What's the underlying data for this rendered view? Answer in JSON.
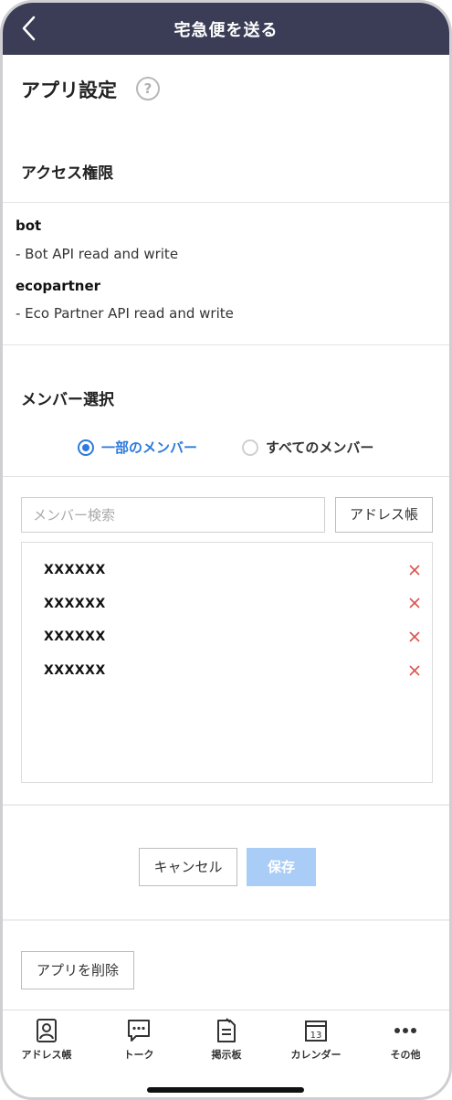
{
  "header": {
    "title": "宅急便を送る"
  },
  "page": {
    "title": "アプリ設定",
    "help_glyph": "?"
  },
  "access": {
    "title": "アクセス権限",
    "permissions": [
      {
        "name": "bot",
        "desc": "- Bot API read and write"
      },
      {
        "name": "ecopartner",
        "desc": "- Eco Partner API read and write"
      }
    ]
  },
  "members": {
    "title": "メンバー選択",
    "options": [
      {
        "label": "一部のメンバー",
        "selected": true
      },
      {
        "label": "すべてのメンバー",
        "selected": false
      }
    ],
    "search_placeholder": "メンバー検索",
    "address_book_label": "アドレス帳",
    "list": [
      "XXXXXX",
      "XXXXXX",
      "XXXXXX",
      "XXXXXX"
    ]
  },
  "actions": {
    "cancel_label": "キャンセル",
    "save_label": "保存",
    "delete_label": "アプリを削除"
  },
  "bottom_nav": {
    "items": [
      {
        "label": "アドレス帳",
        "icon": "address-book-icon"
      },
      {
        "label": "トーク",
        "icon": "chat-icon"
      },
      {
        "label": "掲示板",
        "icon": "board-icon"
      },
      {
        "label": "カレンダー",
        "icon": "calendar-icon",
        "day": "13"
      },
      {
        "label": "その他",
        "icon": "more-icon"
      }
    ]
  },
  "colors": {
    "header_bg": "#3a3d55",
    "accent": "#2d7bdc",
    "save_disabled": "#a9cdf6",
    "remove": "#d9534f"
  }
}
